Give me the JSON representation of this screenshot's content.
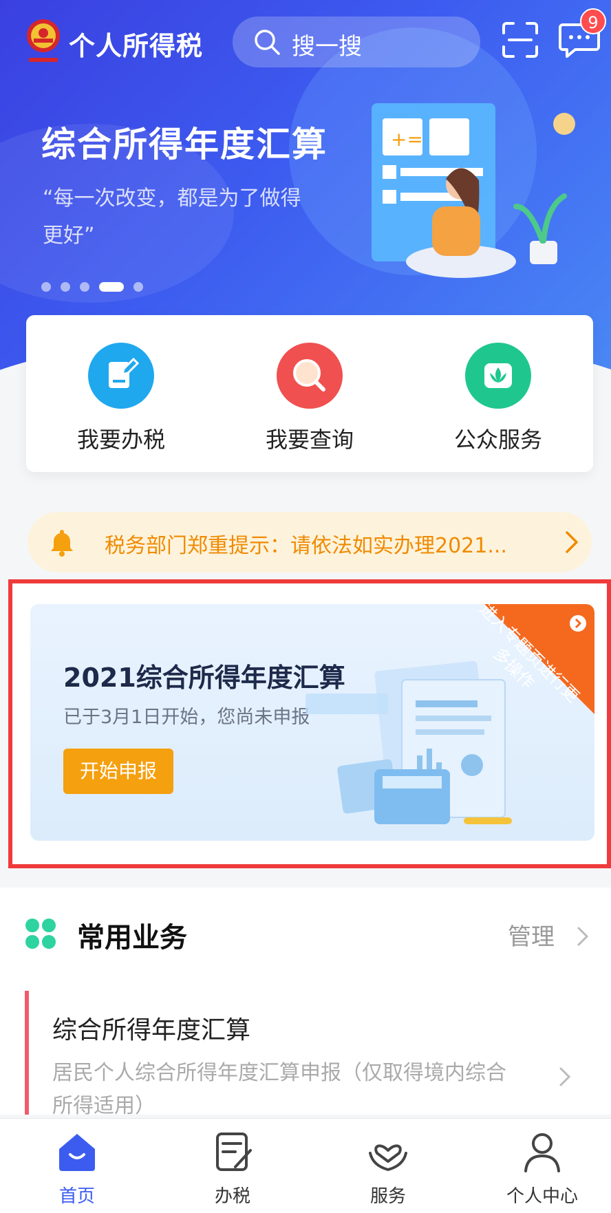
{
  "header": {
    "app_title": "个人所得税",
    "search_placeholder": "搜一搜",
    "message_badge": "9"
  },
  "banner": {
    "title": "综合所得年度汇算",
    "subtitle": "“每一次改变，都是为了做得更好”",
    "dot_count": 5,
    "active_dot": 4
  },
  "quick_actions": [
    {
      "label": "我要办税",
      "icon": "pencil-icon",
      "color": "#1fa8ee"
    },
    {
      "label": "我要查询",
      "icon": "magnifier-icon",
      "color": "#f0504f"
    },
    {
      "label": "公众服务",
      "icon": "lotus-icon",
      "color": "#1fc78f"
    }
  ],
  "notice": {
    "text": "税务部门郑重提示：请依法如实办理2021..."
  },
  "promo": {
    "title": "2021综合所得年度汇算",
    "subtitle": "已于3月1日开始，您尚未申报",
    "button": "开始申报",
    "corner_label": "进入专题页进行更多操作"
  },
  "common": {
    "title": "常用业务",
    "manage": "管理",
    "item": {
      "title": "综合所得年度汇算",
      "desc": "居民个人综合所得年度汇算申报（仅取得境内综合所得适用）"
    }
  },
  "tabbar": [
    {
      "label": "首页",
      "icon": "home-icon",
      "active": true
    },
    {
      "label": "办税",
      "icon": "document-edit-icon",
      "active": false
    },
    {
      "label": "服务",
      "icon": "heart-hands-icon",
      "active": false
    },
    {
      "label": "个人中心",
      "icon": "user-icon",
      "active": false
    }
  ],
  "colors": {
    "primary": "#3c5cf0",
    "notice_text": "#f08a00",
    "button_orange": "#f5a00f",
    "highlight_red": "#ef3b3b"
  }
}
